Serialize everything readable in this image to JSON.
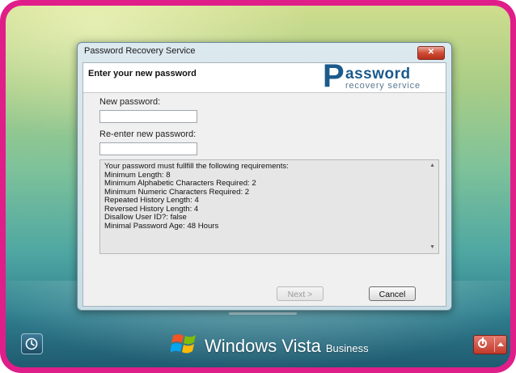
{
  "window": {
    "title": "Password Recovery Service",
    "close_label": "✕"
  },
  "header": {
    "title": "Enter your new password",
    "logo_initial": "P",
    "logo_main": "assword",
    "logo_sub": "recovery service"
  },
  "form": {
    "new_password_label": "New password:",
    "new_password_value": "",
    "reenter_password_label": "Re-enter new password:",
    "reenter_password_value": ""
  },
  "requirements": {
    "lines": [
      "Your password must fullfill the following requirements:",
      "Minimum Length: 8",
      "Minimum Alphabetic Characters Required: 2",
      "Minimum Numeric Characters Required: 2",
      "Repeated History Length: 4",
      "Reversed History Length: 4",
      "Disallow User ID?: false",
      "Minimal Password Age: 48 Hours"
    ]
  },
  "buttons": {
    "next_label": "Next >",
    "cancel_label": "Cancel"
  },
  "taskbar": {
    "brand_main": "Windows Vista",
    "brand_sub": "Business"
  },
  "colors": {
    "frame": "#e01e8a",
    "brand_blue": "#1c5a8c",
    "close_red": "#d04b35"
  }
}
